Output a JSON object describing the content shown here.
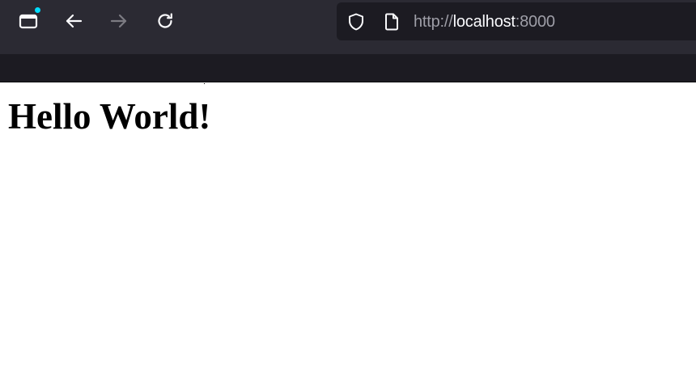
{
  "browser": {
    "toolbar": {
      "buttons": [
        {
          "name": "tab-view-button",
          "icon": "tabs-icon"
        },
        {
          "name": "back-button",
          "icon": "arrow-left-icon"
        },
        {
          "name": "forward-button",
          "icon": "arrow-right-icon",
          "disabled": true
        },
        {
          "name": "reload-button",
          "icon": "reload-icon"
        }
      ],
      "notification_dot_color": "#00ddff"
    },
    "urlbar": {
      "security_icon": "shield-icon",
      "page_icon": "page-icon",
      "url_prefix": "http://",
      "url_host": "localhost",
      "url_port": ":8000"
    }
  },
  "page": {
    "heading": "Hello World!"
  },
  "colors": {
    "toolbar_bg": "#2b2a33",
    "bookmarks_bg": "#1c1b22",
    "url_muted": "#9e9ea7",
    "url_host": "#fbfbfe",
    "page_bg": "#ffffff"
  }
}
